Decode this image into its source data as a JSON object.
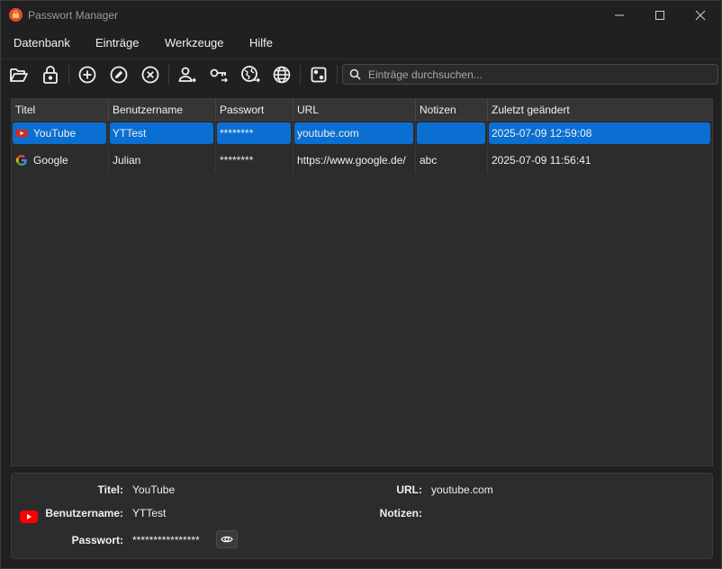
{
  "window": {
    "title": "Passwort Manager",
    "minimize_icon": "minimize-icon",
    "maximize_icon": "maximize-icon",
    "close_icon": "close-icon"
  },
  "menu": {
    "items": [
      "Datenbank",
      "Einträge",
      "Werkzeuge",
      "Hilfe"
    ]
  },
  "toolbar": {
    "buttons": [
      {
        "icon": "open-folder-icon"
      },
      {
        "icon": "lock-icon"
      },
      {
        "icon": "add-icon"
      },
      {
        "icon": "edit-icon"
      },
      {
        "icon": "delete-icon"
      },
      {
        "icon": "copy-username-icon"
      },
      {
        "icon": "copy-password-icon"
      },
      {
        "icon": "open-url-icon"
      },
      {
        "icon": "globe-icon"
      },
      {
        "icon": "dice-icon"
      }
    ]
  },
  "search": {
    "placeholder": "Einträge durchsuchen...",
    "value": ""
  },
  "table": {
    "columns": [
      "Titel",
      "Benutzername",
      "Passwort",
      "URL",
      "Notizen",
      "Zuletzt geändert"
    ],
    "rows": [
      {
        "title": "YouTube",
        "favicon": "youtube-icon",
        "username": "YTTest",
        "password": "********",
        "url": "youtube.com",
        "notes": "",
        "modified": "2025-07-09 12:59:08",
        "selected": true
      },
      {
        "title": "Google",
        "favicon": "google-icon",
        "username": "Julian",
        "password": "********",
        "url": "https://www.google.de/",
        "notes": "abc",
        "modified": "2025-07-09 11:56:41",
        "selected": false
      }
    ]
  },
  "details": {
    "title_label": "Titel:",
    "title_value": "YouTube",
    "username_label": "Benutzername:",
    "username_value": "YTTest",
    "password_label": "Passwort:",
    "password_value": "****************",
    "url_label": "URL:",
    "url_value": "youtube.com",
    "notes_label": "Notizen:",
    "notes_value": "",
    "logo_icon": "youtube-logo-icon",
    "toggle_icon": "eye-icon"
  },
  "colors": {
    "accent": "#0b6fd1",
    "background": "#202020",
    "panel": "#2c2c2c"
  }
}
